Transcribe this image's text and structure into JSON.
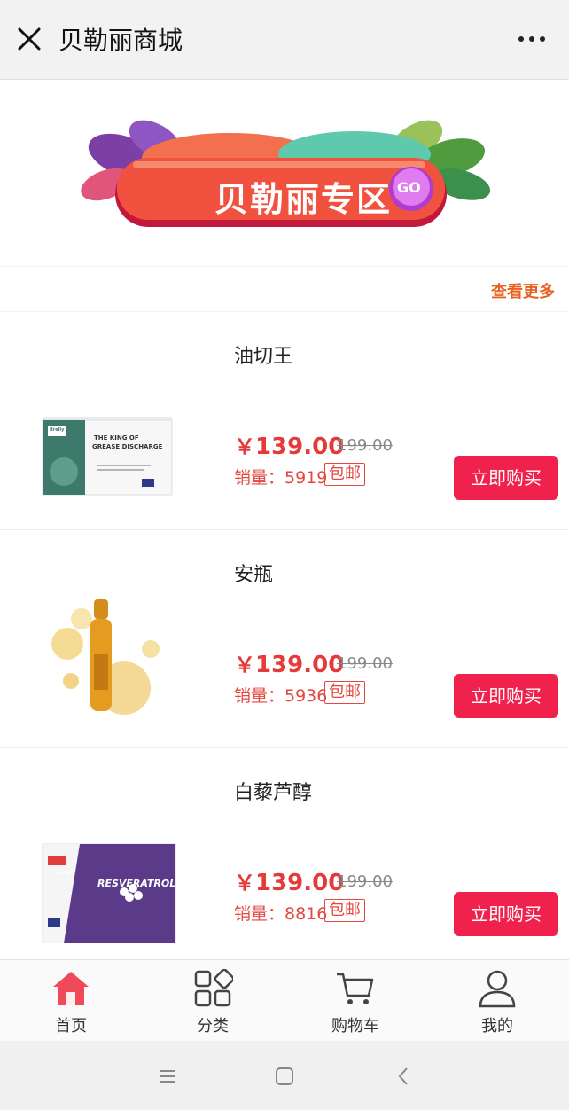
{
  "header": {
    "title": "贝勒丽商城"
  },
  "banner": {
    "text": "贝勒丽专区",
    "go_label": "GO"
  },
  "section": {
    "more_label": "查看更多"
  },
  "products": [
    {
      "name": "油切王",
      "currency": "￥",
      "price": "139.00",
      "original_price": "199.00",
      "sales_label": "销量：5919",
      "badge": "包邮",
      "buy_label": "立即购买",
      "image_text_line1": "THE KING OF",
      "image_text_line2": "GREASE DISCHARGE",
      "brand": "Brelly"
    },
    {
      "name": "安瓶",
      "currency": "￥",
      "price": "139.00",
      "original_price": "199.00",
      "sales_label": "销量：5936",
      "badge": "包邮",
      "buy_label": "立即购买"
    },
    {
      "name": "白藜芦醇",
      "currency": "￥",
      "price": "139.00",
      "original_price": "199.00",
      "sales_label": "销量：8816",
      "badge": "包邮",
      "buy_label": "立即购买",
      "image_text_line1": "RESVERATROL",
      "brand": "Brelly"
    }
  ],
  "tabs": [
    {
      "label": "首页",
      "icon": "home-icon",
      "active": true
    },
    {
      "label": "分类",
      "icon": "category-icon"
    },
    {
      "label": "购物车",
      "icon": "cart-icon"
    },
    {
      "label": "我的",
      "icon": "user-icon"
    }
  ],
  "colors": {
    "accent": "#f1214e",
    "price": "#e63a3a",
    "more": "#e8601f",
    "home_active": "#f04a5a"
  }
}
